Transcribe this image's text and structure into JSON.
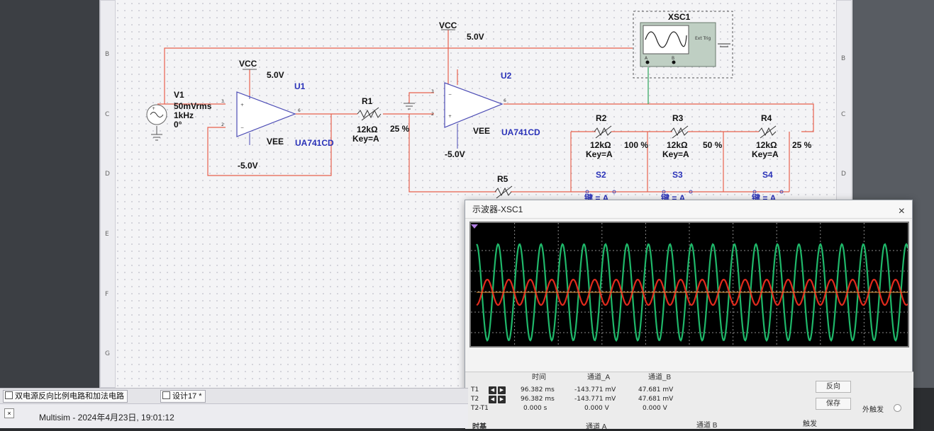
{
  "schematic": {
    "v1": {
      "name": "V1",
      "amplitude": "50mVrms",
      "freq": "1kHz",
      "phase": "0°"
    },
    "vcc_top": {
      "label": "VCC",
      "value": "5.0V"
    },
    "vcc_u1": {
      "label": "VCC",
      "value": "5.0V"
    },
    "u1": {
      "ref": "U1",
      "model": "UA741CD",
      "vee_label": "VEE",
      "vee_value": "-5.0V"
    },
    "u2": {
      "ref": "U2",
      "model": "UA741CD",
      "vee_label": "VEE",
      "vee_value": "-5.0V"
    },
    "r1": {
      "ref": "R1",
      "value": "12kΩ",
      "key": "Key=A",
      "percent": "25 %"
    },
    "r2": {
      "ref": "R2",
      "value": "12kΩ",
      "key": "Key=A",
      "percent": "100 %"
    },
    "r3": {
      "ref": "R3",
      "value": "12kΩ",
      "key": "Key=A",
      "percent": "50 %"
    },
    "r4": {
      "ref": "R4",
      "value": "12kΩ",
      "key": "Key=A",
      "percent": "25 %"
    },
    "r5": {
      "ref": "R5"
    },
    "switches": [
      "S2",
      "S3",
      "S4"
    ],
    "switch_key": "键 = A",
    "xsc1": {
      "ref": "XSC1",
      "ch_a": "A",
      "ch_b": "B",
      "ext_trig": "Ext Trig"
    },
    "row_letters": [
      "B",
      "C",
      "D",
      "E",
      "F",
      "G"
    ]
  },
  "oscilloscope": {
    "title": "示波器-XSC1",
    "close_label": "×",
    "columns": {
      "time": "时间",
      "ch_a": "通道_A",
      "ch_b": "通道_B"
    },
    "rows": [
      {
        "label": "T1",
        "time": "96.382 ms",
        "ch_a": "-143.771 mV",
        "ch_b": "47.681 mV"
      },
      {
        "label": "T2",
        "time": "96.382 ms",
        "ch_a": "-143.771 mV",
        "ch_b": "47.681 mV"
      },
      {
        "label": "T2-T1",
        "time": "0.000 s",
        "ch_a": "0.000 V",
        "ch_b": "0.000 V"
      }
    ],
    "buttons": {
      "reverse": "反向",
      "save": "保存"
    },
    "ext_trigger": "外触发",
    "bottom_labels": {
      "timebase": "时基",
      "channel_a": "通道 A",
      "channel_b": "通道 B",
      "trigger": "触发"
    },
    "colors": {
      "channel_a": "#e02a1c",
      "channel_b": "#1fb86a"
    }
  },
  "tabs": [
    {
      "label": "双电源反向比例电路和加法电路"
    },
    {
      "label": "设计17 *"
    }
  ],
  "status": {
    "text": "Multisim  -  2024年4月23日, 19:01:12"
  }
}
